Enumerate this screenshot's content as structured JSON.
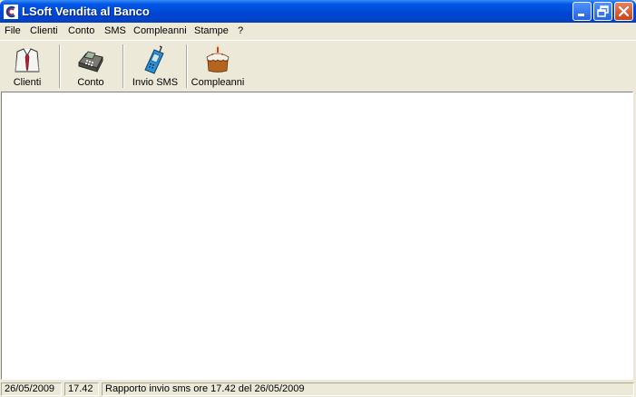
{
  "window": {
    "title": "LSoft Vendita al Banco",
    "app_icon": "lsoft-logo-icon",
    "buttons": [
      "minimize-icon",
      "restore-icon",
      "close-icon"
    ]
  },
  "menubar": {
    "items": [
      "File",
      "Clienti",
      "Conto",
      "SMS",
      "Compleanni",
      "Stampe",
      "?"
    ]
  },
  "toolbar": {
    "buttons": [
      {
        "label": "Clienti",
        "icon": "shirt-tie-icon"
      },
      {
        "label": "Conto",
        "icon": "cash-register-icon"
      },
      {
        "label": "Invio SMS",
        "icon": "mobile-phone-icon"
      },
      {
        "label": "Compleanni",
        "icon": "birthday-cake-icon"
      }
    ]
  },
  "statusbar": {
    "date": "26/05/2009",
    "time": "17.42",
    "message": "Rapporto invio sms ore 17.42 del 26/05/2009"
  },
  "colors": {
    "titlebar": "#0054e3",
    "face": "#ece9d8",
    "close_button": "#d8582c",
    "client_area": "#ffffff"
  }
}
